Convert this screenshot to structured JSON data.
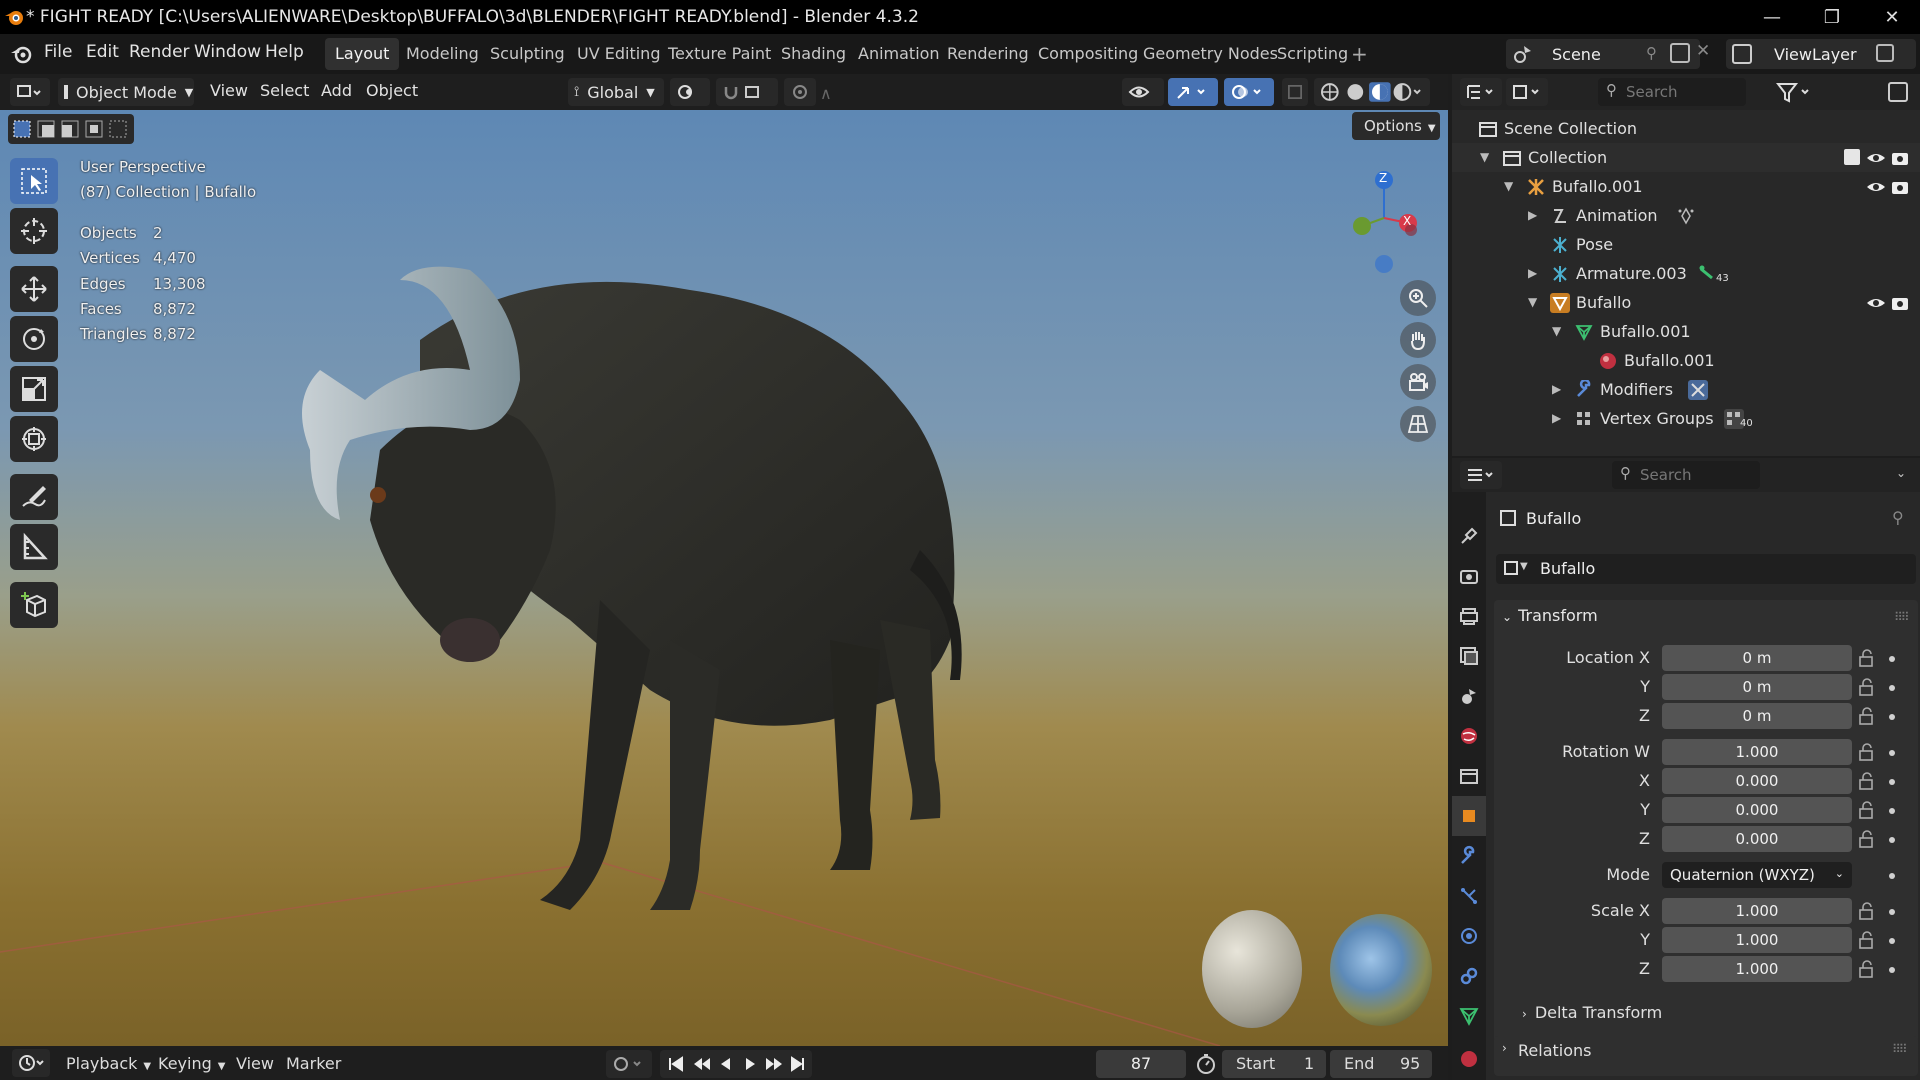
{
  "window": {
    "title": "* FIGHT READY [C:\\Users\\ALIENWARE\\Desktop\\BUFFALO\\3d\\BLENDER\\FIGHT READY.blend] - Blender 4.3.2"
  },
  "menu": {
    "file": "File",
    "edit": "Edit",
    "render": "Render",
    "window": "Window",
    "help": "Help"
  },
  "workspaces": [
    "Layout",
    "Modeling",
    "Sculpting",
    "UV Editing",
    "Texture Paint",
    "Shading",
    "Animation",
    "Rendering",
    "Compositing",
    "Geometry Nodes",
    "Scripting"
  ],
  "active_workspace": "Layout",
  "scene": {
    "name": "Scene",
    "view_layer": "ViewLayer"
  },
  "viewport_header": {
    "mode": "Object Mode",
    "view": "View",
    "select": "Select",
    "add": "Add",
    "object": "Object",
    "orientation": "Global",
    "options": "Options"
  },
  "viewport": {
    "perspective": "User Perspective",
    "context": "(87) Collection | Bufallo",
    "stats": [
      {
        "label": "Objects",
        "value": "2"
      },
      {
        "label": "Vertices",
        "value": "4,470"
      },
      {
        "label": "Edges",
        "value": "13,308"
      },
      {
        "label": "Faces",
        "value": "8,872"
      },
      {
        "label": "Triangles",
        "value": "8,872"
      }
    ],
    "gizmo": {
      "z": "Z",
      "x": "X"
    }
  },
  "timeline": {
    "playback": "Playback",
    "keying": "Keying",
    "view": "View",
    "marker": "Marker",
    "current_frame": "87",
    "start_label": "Start",
    "start": "1",
    "end_label": "End",
    "end": "95"
  },
  "outliner": {
    "search_placeholder": "Search",
    "rows": [
      {
        "label": "Scene Collection",
        "badge": ""
      },
      {
        "label": "Collection",
        "badge": ""
      },
      {
        "label": "Bufallo.001",
        "badge": ""
      },
      {
        "label": "Animation",
        "badge": ""
      },
      {
        "label": "Pose",
        "badge": ""
      },
      {
        "label": "Armature.003",
        "badge": "43"
      },
      {
        "label": "Bufallo",
        "badge": ""
      },
      {
        "label": "Bufallo.001",
        "badge": ""
      },
      {
        "label": "Bufallo.001",
        "badge": ""
      },
      {
        "label": "Modifiers",
        "badge": ""
      },
      {
        "label": "Vertex Groups",
        "badge": "40"
      }
    ]
  },
  "properties": {
    "search_placeholder": "Search",
    "object_name": "Bufallo",
    "datablock": "Bufallo",
    "transform_panel": "Transform",
    "location": {
      "label_x": "Location X",
      "x": "0 m",
      "y": "0 m",
      "z": "0 m"
    },
    "rotation": {
      "label_w": "Rotation W",
      "w": "1.000",
      "x": "0.000",
      "y": "0.000",
      "z": "0.000"
    },
    "mode_label": "Mode",
    "mode": "Quaternion (WXYZ)",
    "scale": {
      "label_x": "Scale X",
      "x": "1.000",
      "y": "1.000",
      "z": "1.000"
    },
    "axis_y": "Y",
    "axis_z": "Z",
    "axis_x": "X",
    "delta_transform": "Delta Transform",
    "relations": "Relations"
  },
  "colors": {
    "accent": "#4772b3",
    "bg": "#1d1d1d",
    "panel": "#282828",
    "field": "#545454"
  }
}
